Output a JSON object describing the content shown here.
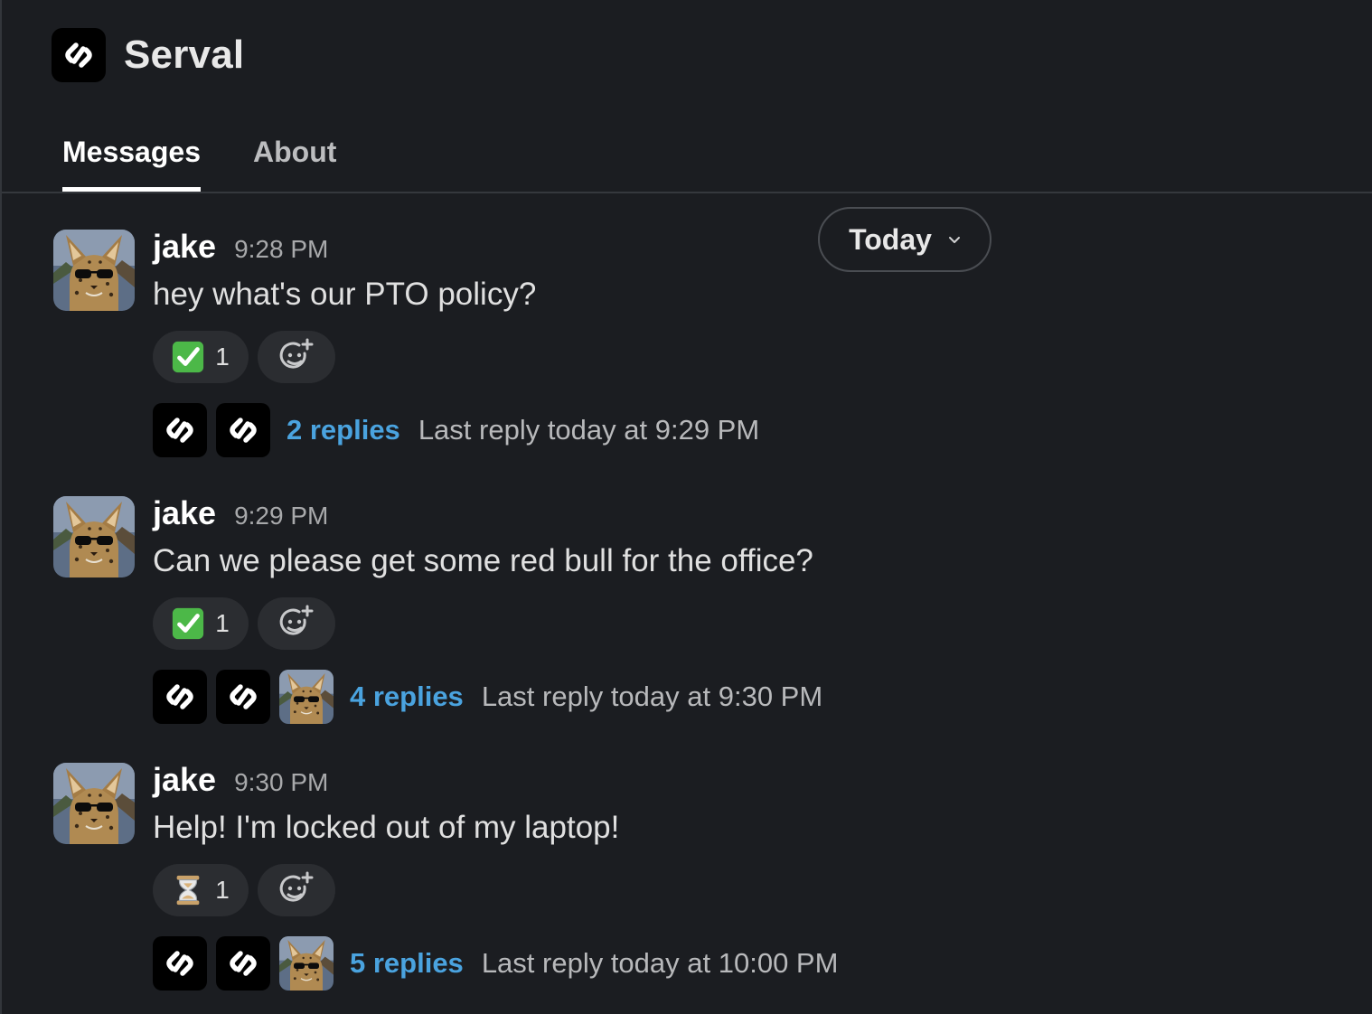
{
  "app": {
    "title": "Serval"
  },
  "tabs": [
    {
      "label": "Messages",
      "active": true
    },
    {
      "label": "About",
      "active": false
    }
  ],
  "date_filter": {
    "label": "Today"
  },
  "messages": [
    {
      "author": "jake",
      "time": "9:28 PM",
      "text": "hey what's our PTO policy?",
      "reaction": {
        "emoji": "white-check-mark",
        "count": "1"
      },
      "thread": {
        "participants": [
          "serval",
          "serval"
        ],
        "replies": "2 replies",
        "last_reply": "Last reply today at 9:29 PM"
      }
    },
    {
      "author": "jake",
      "time": "9:29 PM",
      "text": "Can we please get some red bull for the office?",
      "reaction": {
        "emoji": "white-check-mark",
        "count": "1"
      },
      "thread": {
        "participants": [
          "serval",
          "serval",
          "jake"
        ],
        "replies": "4 replies",
        "last_reply": "Last reply today at 9:30 PM"
      }
    },
    {
      "author": "jake",
      "time": "9:30 PM",
      "text": "Help! I'm locked out of my laptop!",
      "reaction": {
        "emoji": "hourglass",
        "count": "1"
      },
      "thread": {
        "participants": [
          "serval",
          "serval",
          "jake"
        ],
        "replies": "5 replies",
        "last_reply": "Last reply today at 10:00 PM"
      }
    }
  ],
  "colors": {
    "background": "#1b1d21",
    "link": "#4aa3df",
    "reaction_bg": "#2b2d31"
  }
}
